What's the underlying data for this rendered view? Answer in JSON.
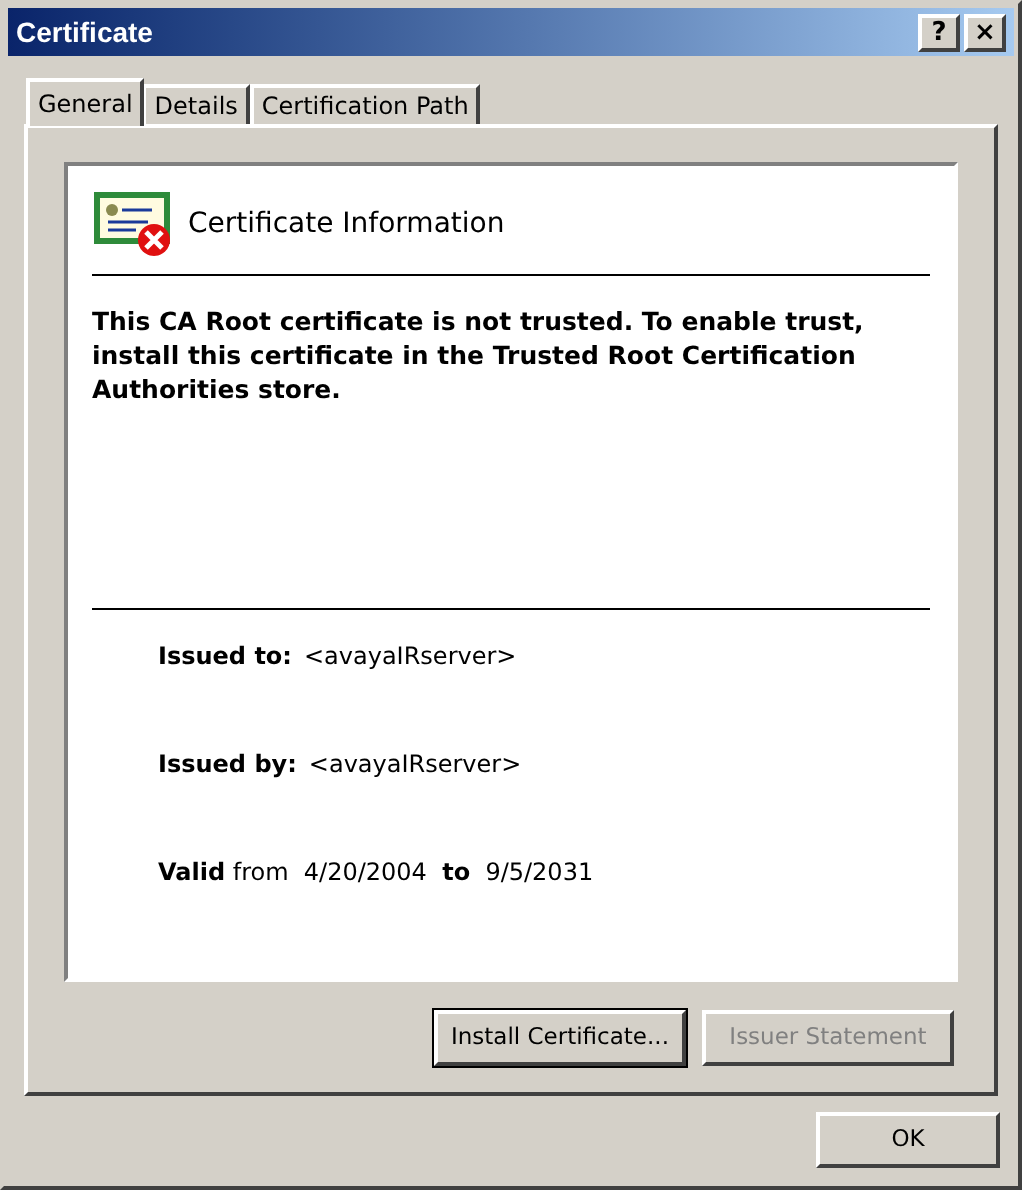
{
  "window": {
    "title": "Certificate",
    "controls": [
      "?",
      "×"
    ]
  },
  "tabs": [
    {
      "label": "General",
      "selected": true
    },
    {
      "label": "Details",
      "selected": false
    },
    {
      "label": "Certification Path",
      "selected": false
    }
  ],
  "info": {
    "heading": "Certificate Information",
    "message": "This CA Root certificate is not trusted. To enable trust, install this certificate in the Trusted Root Certification Authorities store.",
    "fields": [
      {
        "label": "Issued to:",
        "value": "<avayaIRserver>"
      },
      {
        "label": "Issued by:",
        "value": "<avayaIRserver>"
      }
    ],
    "validity": "**Valid** from  4/20/2004  **to**  9/5/2031"
  },
  "buttons": [
    {
      "label": "Install Certificate...",
      "disabled": false,
      "default": true
    },
    {
      "label": "Issuer Statement",
      "disabled": true,
      "default": false
    }
  ],
  "footer_buttons": [
    {
      "label": "OK",
      "disabled": false,
      "default": false
    }
  ]
}
